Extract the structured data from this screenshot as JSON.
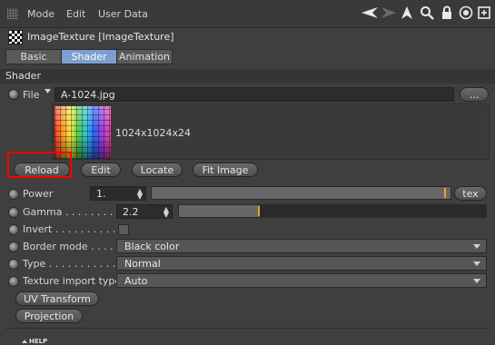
{
  "menubar": {
    "items": [
      "Mode",
      "Edit",
      "User Data"
    ],
    "toolbar_icons": [
      "back-arrow-icon",
      "forward-arrow-icon",
      "pointer-up-icon",
      "search-icon",
      "lock-icon",
      "target-icon",
      "new-window-icon"
    ]
  },
  "object": {
    "icon": "checker-texture-icon",
    "title": "ImageTexture [ImageTexture]"
  },
  "tabs": [
    {
      "label": "Basic",
      "active": false
    },
    {
      "label": "Shader",
      "active": true
    },
    {
      "label": "Animation",
      "active": false
    }
  ],
  "section": {
    "title": "Shader"
  },
  "file": {
    "label": "File",
    "value": "A-1024.jpg",
    "browse_label": "..."
  },
  "preview": {
    "resolution": "1024x1024x24"
  },
  "actions": {
    "reload": "Reload",
    "edit": "Edit",
    "locate": "Locate",
    "fit_image": "Fit Image"
  },
  "params": {
    "power": {
      "label": "Power",
      "value": "1.",
      "level": 0.985,
      "tex_label": "tex"
    },
    "gamma": {
      "label": "Gamma . . . . . . . . .",
      "value": "2.2",
      "level": 0.26
    },
    "invert": {
      "label": "Invert . . . . . . . . . . .",
      "checked": false
    },
    "border_mode": {
      "label": "Border mode . . . . .",
      "value": "Black color"
    },
    "type": {
      "label": "Type . . . . . . . . . . . .",
      "value": "Normal"
    },
    "texture_import_type": {
      "label": "Texture import type",
      "value": "Auto"
    }
  },
  "extra_buttons": {
    "uv_transform": "UV Transform",
    "projection": "Projection"
  },
  "help": {
    "label": "HELP"
  },
  "colors": {
    "accent_tab": "#7d9fce",
    "slider_knob": "#f0a020",
    "highlight": "#ff0000"
  }
}
